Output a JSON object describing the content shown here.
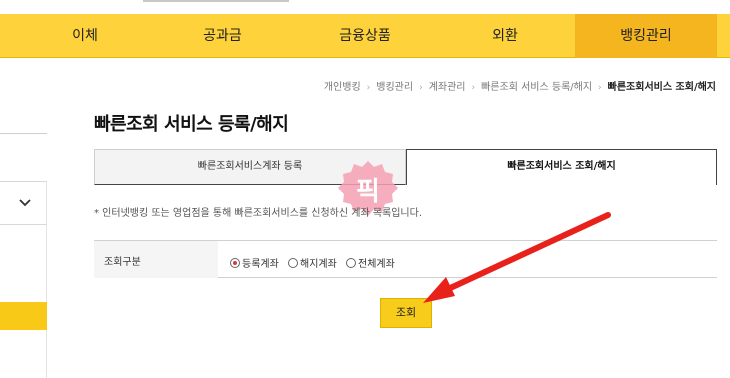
{
  "nav": {
    "items": [
      "이체",
      "공과금",
      "금융상품",
      "외환",
      "뱅킹관리"
    ],
    "active": "뱅킹관리"
  },
  "breadcrumb": [
    "개인뱅킹",
    "뱅킹관리",
    "계좌관리",
    "빠른조회 서비스 등록/해지",
    "빠른조회서비스 조회/해지"
  ],
  "page": {
    "title": "빠른조회 서비스 등록/해지",
    "notice": "* 인터넷뱅킹 또는 영업점을 통해 빠른조회서비스를 신청하신 계좌 목록입니다."
  },
  "tabs": [
    {
      "label": "빠른조회서비스계좌 등록",
      "active": false
    },
    {
      "label": "빠른조회서비스 조회/해지",
      "active": true
    }
  ],
  "form": {
    "label": "조회구분",
    "options": [
      "등록계좌",
      "해지계좌",
      "전체계좌"
    ],
    "selected": "등록계좌"
  },
  "watermark": {
    "text": "픽"
  },
  "buttons": {
    "search": "조회"
  },
  "colors": {
    "nav_bg": "#fdd23a",
    "nav_active": "#f5b51f",
    "button": "#f8cc1a",
    "annotation_arrow": "#e8221b",
    "watermark": "#f4a0b4"
  }
}
